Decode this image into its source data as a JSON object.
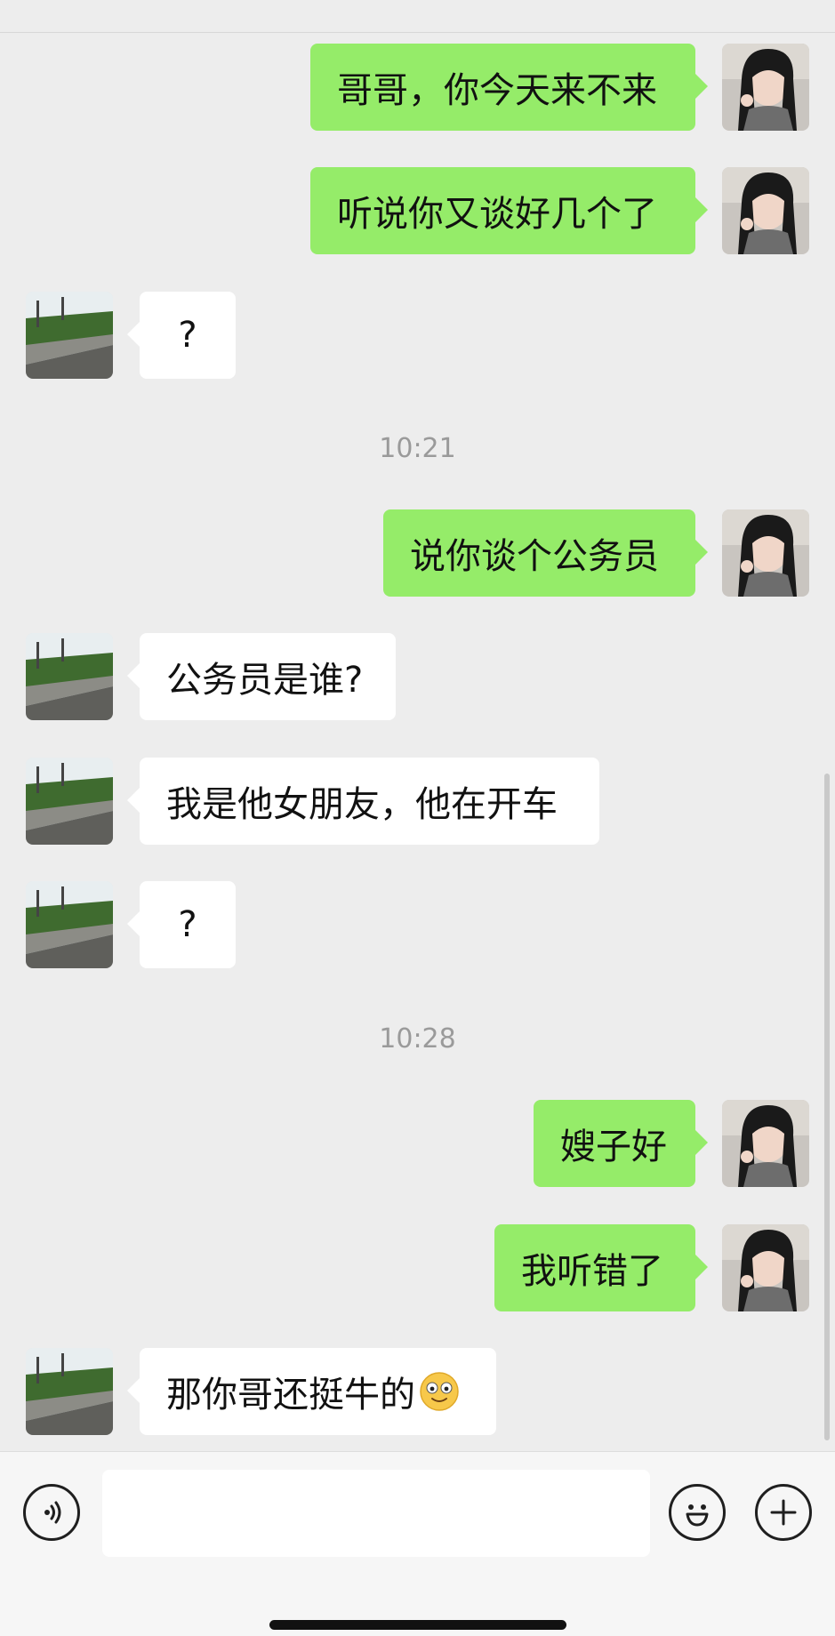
{
  "messages": [
    {
      "from": "me",
      "text": "哥哥，你今天来不来"
    },
    {
      "from": "me",
      "text": "听说你又谈好几个了"
    },
    {
      "from": "them",
      "text": "?"
    },
    {
      "type": "time",
      "text": "10:21"
    },
    {
      "from": "me",
      "text": "说你谈个公务员"
    },
    {
      "from": "them",
      "text": "公务员是谁?"
    },
    {
      "from": "them",
      "text": "我是他女朋友，他在开车"
    },
    {
      "from": "them",
      "text": "?"
    },
    {
      "type": "time",
      "text": "10:28"
    },
    {
      "from": "me",
      "text": "嫂子好"
    },
    {
      "from": "me",
      "text": "我听错了"
    },
    {
      "from": "them",
      "text": "那你哥还挺牛的",
      "emoji": "flushed-smile-emoji"
    }
  ],
  "input": {
    "placeholder": "",
    "value": ""
  },
  "icons": {
    "voice": "voice-icon",
    "emoji": "emoji-icon",
    "plus": "plus-icon",
    "my_avatar": "avatar-girl",
    "their_avatar": "avatar-road"
  },
  "colors": {
    "sent_bubble": "#95ec69",
    "received_bubble": "#ffffff",
    "background": "#ededed"
  }
}
